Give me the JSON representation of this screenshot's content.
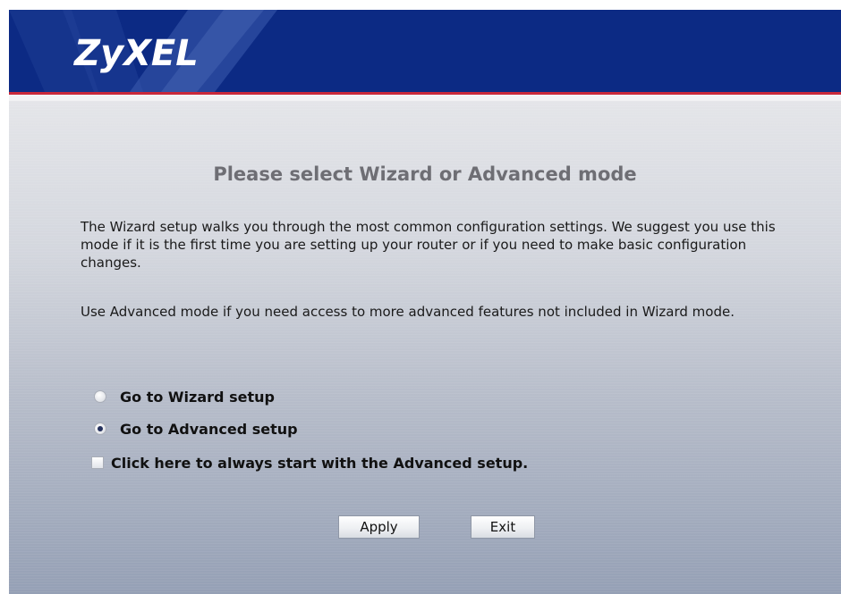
{
  "header": {
    "brand": "ZyXEL",
    "colors": {
      "banner": "#0c2a84",
      "accent_stripe": "#c8283a"
    }
  },
  "page": {
    "title": "Please select Wizard or Advanced mode",
    "paragraph_1": "The Wizard setup walks you through the most common configuration settings. We suggest you use this mode if it is the first time you are setting up your router or if you need to make basic configuration changes.",
    "paragraph_2": "Use Advanced mode if you need access to more advanced features not included in Wizard mode."
  },
  "options": {
    "wizard": {
      "label": "Go to Wizard setup",
      "checked": false
    },
    "advanced": {
      "label": "Go to Advanced setup",
      "checked": true
    },
    "always_advanced": {
      "label": "Click here to always start with the Advanced setup.",
      "checked": false
    }
  },
  "buttons": {
    "apply": "Apply",
    "exit": "Exit"
  }
}
